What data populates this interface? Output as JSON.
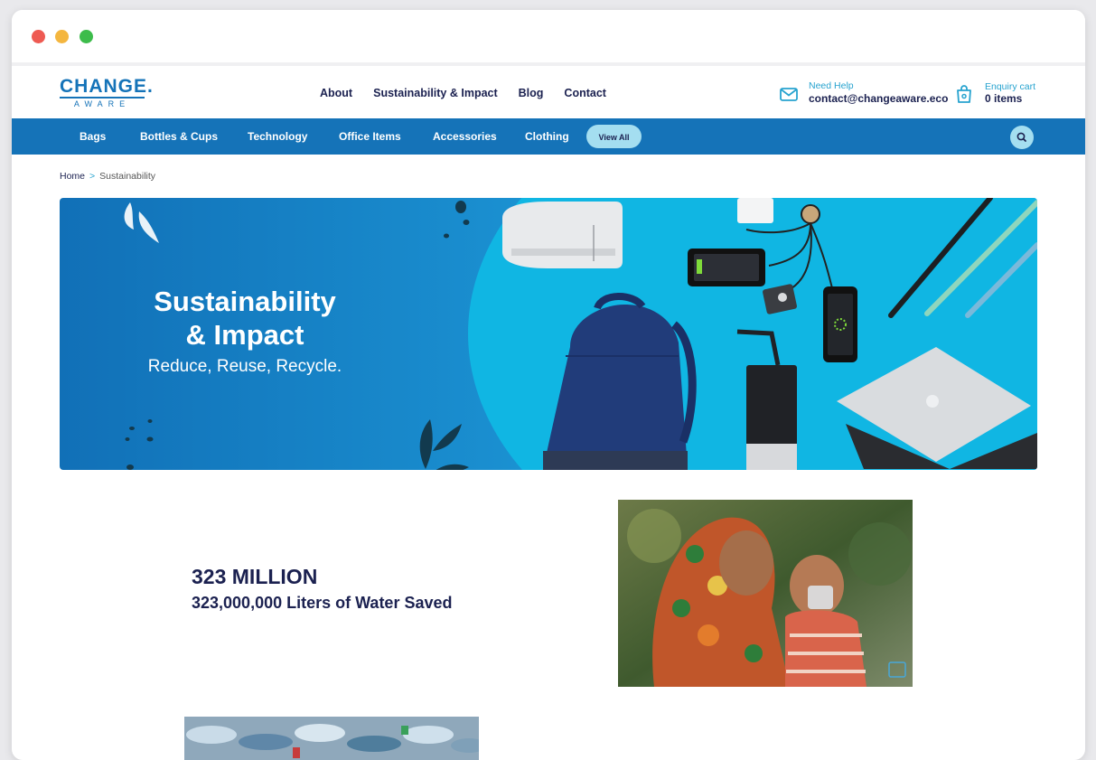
{
  "logo": {
    "main": "CHANGE.",
    "sub": "AWARE"
  },
  "top_nav": [
    "About",
    "Sustainability & Impact",
    "Blog",
    "Contact"
  ],
  "help": {
    "label": "Need Help",
    "email": "contact@changeaware.eco"
  },
  "cart": {
    "label": "Enquiry cart",
    "count": "0 items"
  },
  "categories": [
    "Bags",
    "Bottles & Cups",
    "Technology",
    "Office Items",
    "Accessories",
    "Clothing"
  ],
  "view_all": "View All",
  "breadcrumb": {
    "home": "Home",
    "separator": ">",
    "current": "Sustainability"
  },
  "hero": {
    "title_line1": "Sustainability",
    "title_line2": "& Impact",
    "subtitle": "Reduce, Reuse, Recycle."
  },
  "stat": {
    "headline": "323 MILLION",
    "detail": "323,000,000 Liters of Water Saved"
  },
  "colors": {
    "brand_blue": "#1573b8",
    "accent_cyan": "#27b1d6",
    "navy_text": "#1b2150",
    "pill": "#a4def0"
  }
}
